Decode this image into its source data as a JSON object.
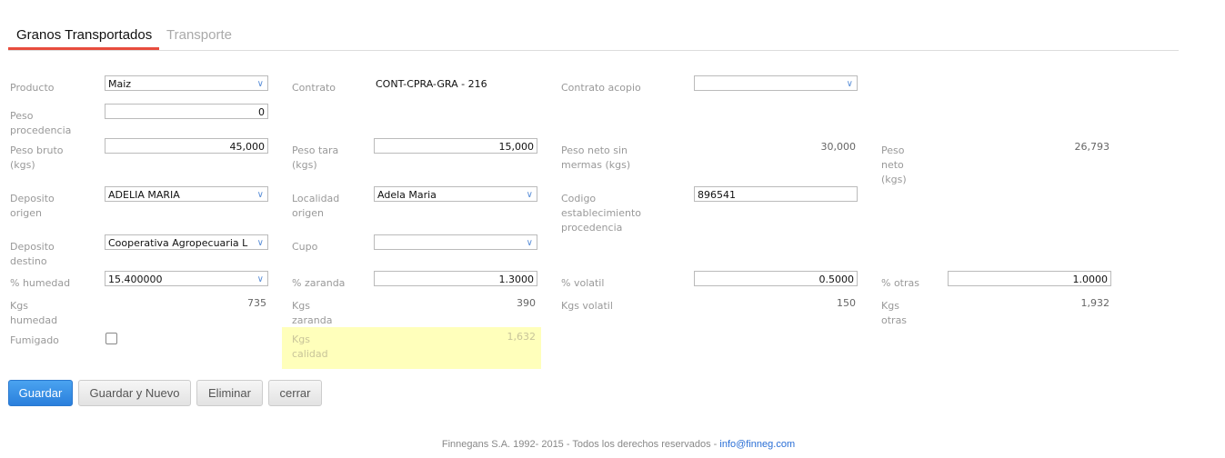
{
  "tabs": [
    {
      "label": "Granos Transportados",
      "active": true
    },
    {
      "label": "Transporte",
      "active": false
    }
  ],
  "form": {
    "producto": {
      "label": "Producto",
      "value": "Maiz"
    },
    "contrato": {
      "label": "Contrato",
      "value": "CONT-CPRA-GRA - 216"
    },
    "contrato_acopio": {
      "label": "Contrato acopio",
      "value": ""
    },
    "peso_procedencia": {
      "label1": "Peso",
      "label2": "procedencia",
      "value": "0"
    },
    "peso_bruto": {
      "label1": "Peso bruto",
      "label2": "(kgs)",
      "value": "45,000"
    },
    "peso_tara": {
      "label1": "Peso tara",
      "label2": "(kgs)",
      "value": "15,000"
    },
    "peso_neto_sin_mermas": {
      "label1": "Peso neto sin",
      "label2": "mermas (kgs)",
      "value": "30,000"
    },
    "peso_neto": {
      "label1": "Peso",
      "label2": "neto",
      "label3": "(kgs)",
      "value": "26,793"
    },
    "deposito_origen": {
      "label1": "Deposito",
      "label2": "origen",
      "value": "ADELIA MARIA"
    },
    "localidad_origen": {
      "label1": "Localidad",
      "label2": "origen",
      "value": "Adela Maria"
    },
    "codigo_establecimiento": {
      "label1": "Codigo",
      "label2": "establecimiento",
      "label3": "procedencia",
      "value": "896541"
    },
    "deposito_destino": {
      "label1": "Deposito",
      "label2": "destino",
      "value": "Cooperativa Agropecuaria L"
    },
    "cupo": {
      "label": "Cupo",
      "value": ""
    },
    "humedad": {
      "label": "% humedad",
      "value": "15.400000"
    },
    "zaranda": {
      "label": "% zaranda",
      "value": "1.3000"
    },
    "volatil": {
      "label": "% volatil",
      "value": "0.5000"
    },
    "otras": {
      "label": "% otras",
      "value": "1.0000"
    },
    "kgs_humedad": {
      "label1": "Kgs",
      "label2": "humedad",
      "value": "735"
    },
    "kgs_zaranda": {
      "label1": "Kgs",
      "label2": "zaranda",
      "value": "390"
    },
    "kgs_volatil": {
      "label": "Kgs volatil",
      "value": "150"
    },
    "kgs_otras": {
      "label1": "Kgs",
      "label2": "otras",
      "value": "1,932"
    },
    "fumigado": {
      "label": "Fumigado",
      "checked": false
    },
    "kgs_calidad": {
      "label1": "Kgs",
      "label2": "calidad",
      "value": "1,632",
      "highlight": "#ffffbb"
    }
  },
  "buttons": {
    "guardar": "Guardar",
    "guardar_nuevo": "Guardar y Nuevo",
    "eliminar": "Eliminar",
    "cerrar": "cerrar"
  },
  "footer": {
    "text": "Finnegans S.A. 1992- 2015 - Todos los derechos reservados - ",
    "email": "info@finneg.com"
  },
  "colors": {
    "accent": "#e84c3d",
    "primary": "#2a7fdc"
  }
}
